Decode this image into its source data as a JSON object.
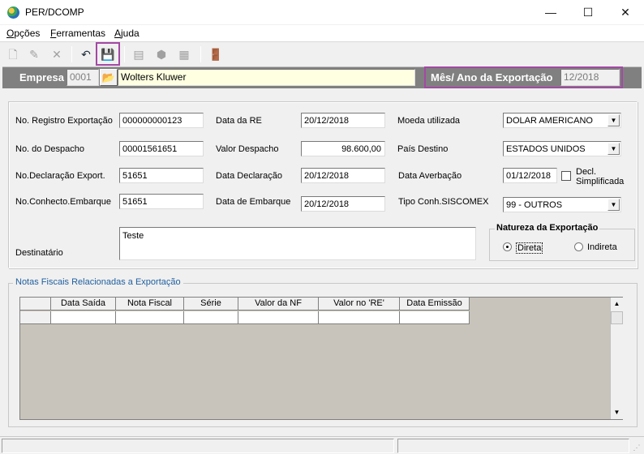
{
  "window": {
    "title": "PER/DCOMP"
  },
  "menu": {
    "items": [
      "Opções",
      "Ferramentas",
      "Ajuda"
    ]
  },
  "header": {
    "empresa_label": "Empresa",
    "empresa_code": "0001",
    "empresa_name": "Wolters Kluwer",
    "mes_ano_label": "Mês/ Ano da Exportação",
    "mes_ano_value": "12/2018"
  },
  "form": {
    "registro_label": "No. Registro Exportação",
    "registro_value": "000000000123",
    "data_re_label": "Data da RE",
    "data_re_value": "20/12/2018",
    "moeda_label": "Moeda utilizada",
    "moeda_value": "DOLAR AMERICANO",
    "despacho_label": "No. do Despacho",
    "despacho_value": "00001561651",
    "valor_despacho_label": "Valor  Despacho",
    "valor_despacho_value": "98.600,00",
    "pais_label": "País Destino",
    "pais_value": "ESTADOS UNIDOS",
    "declaracao_label": "No.Declaração Export.",
    "declaracao_value": "51651",
    "data_declaracao_label": "Data Declaração",
    "data_declaracao_value": "20/12/2018",
    "data_averbacao_label": "Data Averbação",
    "data_averbacao_value": "01/12/2018",
    "decl_simplificada_line1": "Decl.",
    "decl_simplificada_line2": "Simplificada",
    "conhecto_label": "No.Conhecto.Embarque",
    "conhecto_value": "51651",
    "data_embarque_label": "Data de Embarque",
    "data_embarque_value": "20/12/2018",
    "tipo_conh_label": "Tipo Conh.SISCOMEX",
    "tipo_conh_value": "99 - OUTROS",
    "destinatario_label": "Destinatário",
    "destinatario_value": "Teste"
  },
  "natureza": {
    "title": "Natureza da Exportação",
    "direta_label": "Direta",
    "indireta_label": "Indireta",
    "selected": "Direta"
  },
  "notas": {
    "title": "Notas Fiscais Relacionadas a Exportação",
    "columns": [
      "Data Saída",
      "Nota Fiscal",
      "Série",
      "Valor da NF",
      "Valor no 'RE'",
      "Data Emissão"
    ]
  }
}
